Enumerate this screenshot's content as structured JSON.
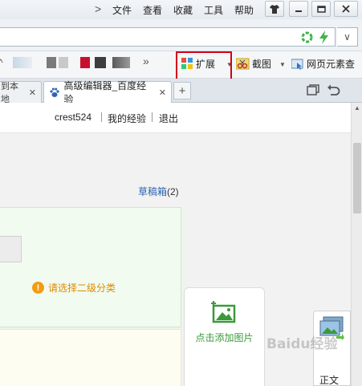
{
  "menubar": {
    "chevron": ">",
    "items": [
      "文件",
      "查看",
      "收藏",
      "工具",
      "帮助"
    ],
    "window_buttons": [
      "shirt-icon",
      "minimize-icon",
      "restore-icon",
      "close-icon"
    ]
  },
  "address": {
    "value": "",
    "dropdown": "∨"
  },
  "toolbar": {
    "overflow": "»",
    "extension_label": "扩展",
    "screenshot_label": "截图",
    "inspect_label": "网页元素查"
  },
  "tabs": [
    {
      "label": "到本地"
    },
    {
      "label": "高级编辑器_百度经验",
      "active": true
    }
  ],
  "newtab_label": "+",
  "page": {
    "username": "crest524",
    "my_exp": "我的经验",
    "logout": "退出",
    "drafts_label": "草稿箱",
    "drafts_count": "(2)",
    "warning_text": "请选择二级分类",
    "add_image_label": "点击添加图片",
    "side_label": "正文"
  },
  "watermark": "Baidu经验",
  "colors": {
    "highlight": "#d0021b",
    "link": "#2d64b3",
    "warning": "#e08a00",
    "green": "#3a9a3a"
  }
}
